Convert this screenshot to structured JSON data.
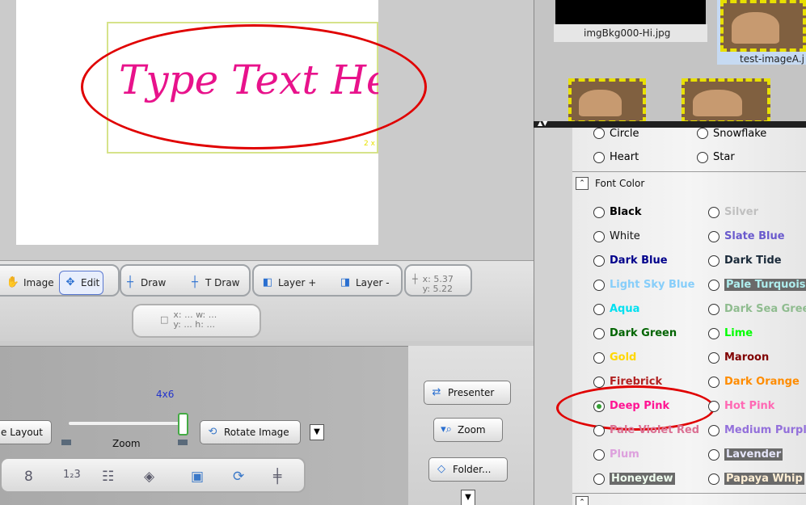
{
  "canvas": {
    "text": "Type Text Here",
    "corner_mark": "2 x"
  },
  "toolbar": {
    "image_label": "Image",
    "edit_label": "Edit",
    "draw_label": "Draw",
    "text_draw_label": "T Draw",
    "layer_plus_label": "Layer +",
    "layer_minus_label": "Layer -",
    "cursor_x": "x: 5.37",
    "cursor_y": "y: 5.22",
    "box_xw": "x: ... w: ...",
    "box_yh": "y: ... h: ..."
  },
  "bottom": {
    "layout_label": "e Layout",
    "size_label": "4x6",
    "zoom_label": "Zoom",
    "zoom_level": 1.0,
    "rotate_label": "Rotate Image",
    "presenter_label": "Presenter",
    "zoom_button_label": "Zoom",
    "folder_label": "Folder..."
  },
  "thumbnails": {
    "left_caption": "imgBkg000-Hi.jpg",
    "right_caption": "test-imageA.j"
  },
  "shapes": {
    "circle": "Circle",
    "snowflake": "Snowflake",
    "heart": "Heart",
    "star": "Star"
  },
  "font_color": {
    "section_label": "Font Color",
    "selected": "Deep Pink",
    "left": [
      {
        "label": "Black",
        "color": "#000000"
      },
      {
        "label": "White",
        "color": "#111111"
      },
      {
        "label": "Dark Blue",
        "color": "#00008b"
      },
      {
        "label": "Light Sky Blue",
        "color": "#87cefa"
      },
      {
        "label": "Aqua",
        "color": "#00e0f0"
      },
      {
        "label": "Dark Green",
        "color": "#006400"
      },
      {
        "label": "Gold",
        "color": "#ffd700"
      },
      {
        "label": "Firebrick",
        "color": "#b22222"
      },
      {
        "label": "Deep Pink",
        "color": "#ff1493"
      },
      {
        "label": "Pale Violet Red",
        "color": "#db7093"
      },
      {
        "label": "Plum",
        "color": "#dda0dd"
      },
      {
        "label": "Honeydew",
        "color": "#f0fff0"
      }
    ],
    "right": [
      {
        "label": "Silver",
        "color": "#c0c0c0"
      },
      {
        "label": "Slate Blue",
        "color": "#6a5acd"
      },
      {
        "label": "Dark Tide",
        "color": "#1a2a3a"
      },
      {
        "label": "Pale Turquoise",
        "color": "#afeeee"
      },
      {
        "label": "Dark Sea Green",
        "color": "#8fbc8f"
      },
      {
        "label": "Lime",
        "color": "#00ff00"
      },
      {
        "label": "Maroon",
        "color": "#800000"
      },
      {
        "label": "Dark Orange",
        "color": "#ff8c00"
      },
      {
        "label": "Hot Pink",
        "color": "#ff69b4"
      },
      {
        "label": "Medium Purple",
        "color": "#9370db"
      },
      {
        "label": "Lavender",
        "color": "#e6e6fa"
      },
      {
        "label": "Papaya Whip",
        "color": "#ffefd5"
      }
    ]
  }
}
